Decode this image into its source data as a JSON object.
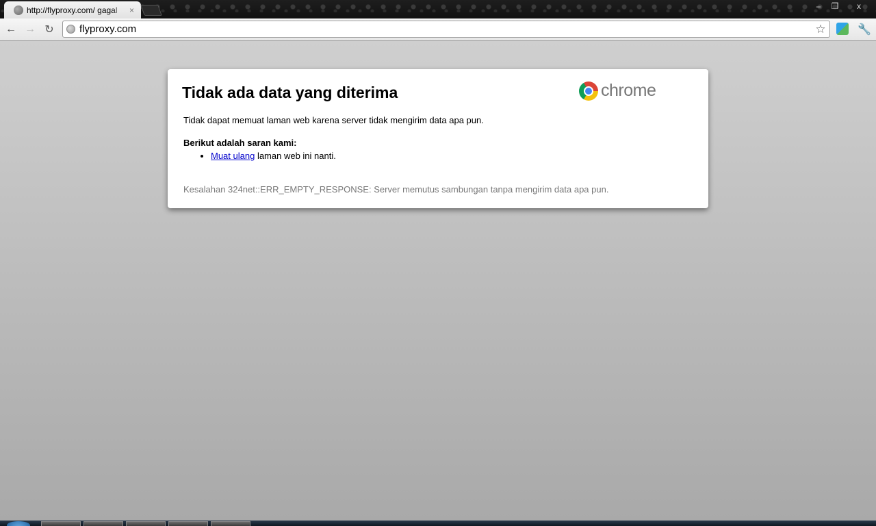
{
  "window": {
    "minimize_glyph": "‒",
    "maximize_glyph": "❐",
    "close_glyph": "x"
  },
  "tab": {
    "title": "http://flyproxy.com/ gagal",
    "close_glyph": "×"
  },
  "toolbar": {
    "back_glyph": "←",
    "forward_glyph": "→",
    "reload_glyph": "↻",
    "address": "flyproxy.com",
    "star_glyph": "☆",
    "wrench_glyph": "🔧"
  },
  "error_page": {
    "title": "Tidak ada data yang diterima",
    "brand": "chrome",
    "description": "Tidak dapat memuat laman web karena server tidak mengirim data apa pun.",
    "suggestions_heading": "Berikut adalah saran kami:",
    "suggestion_link": "Muat ulang",
    "suggestion_rest": " laman web ini nanti.",
    "error_code": "Kesalahan 324net::ERR_EMPTY_RESPONSE: Server memutus sambungan tanpa mengirim data apa pun."
  },
  "icons": {
    "tab_favicon": "globe-icon",
    "omnibox": "page-icon",
    "star": "star-icon",
    "extension": "extension-icon",
    "wrench": "wrench-icon",
    "logo": "chrome-logo-icon"
  },
  "colors": {
    "link": "#0000cc",
    "error_code_text": "#777777",
    "page_bg_top": "#cfcfcf",
    "page_bg_bottom": "#a9a9a9"
  }
}
